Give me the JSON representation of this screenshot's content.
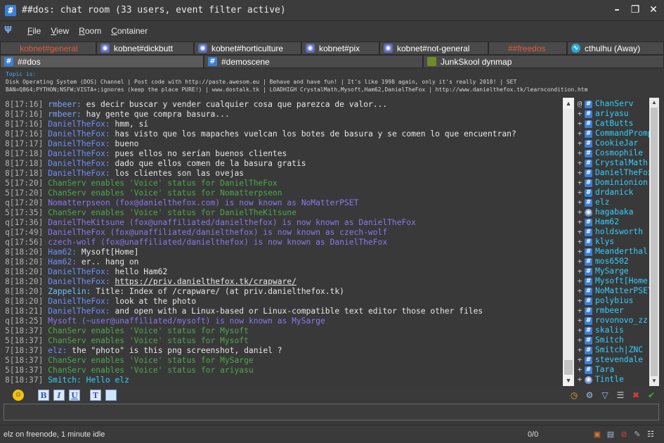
{
  "window": {
    "title": "##dos: chat room (33 users, event filter active)",
    "app_icon": "#"
  },
  "menu": [
    "File",
    "View",
    "Room",
    "Container"
  ],
  "tabs_row1": [
    {
      "label": "kobnet#general",
      "icon": "blank",
      "red": true
    },
    {
      "label": "kobnet#dickbutt",
      "icon": "discord",
      "red": false
    },
    {
      "label": "kobnet#horticulture",
      "icon": "discord",
      "red": false
    },
    {
      "label": "kobnet#pix",
      "icon": "discord",
      "red": false
    },
    {
      "label": "kobnet#not-general",
      "icon": "discord",
      "red": false
    },
    {
      "label": "##freedos",
      "icon": "blank",
      "red": true
    },
    {
      "label": "cthulhu (Away)",
      "icon": "cthulhu",
      "red": false
    }
  ],
  "tabs_row2": [
    {
      "label": "##dos",
      "icon": "hash",
      "active": true
    },
    {
      "label": "#demoscene",
      "icon": "hash",
      "active": false
    },
    {
      "label": "JunkSkool dynmap",
      "icon": "junk",
      "active": false
    }
  ],
  "topic": {
    "label": "Topic is:",
    "line1": "Disk Operating System (DOS) Channel | Post code with http://paste.awesom.eu | Behave and have fun! | It's like 1998 again, only it's really 2018! | SET",
    "line2": "BAN=Q864;PYTHON;NSFW;VISTA+;ignores (keep the place PURE!) | www.dostalk.tk | LOADHIGH CrystalMath,Mysoft,Ham62,DanielTheFox | http://www.danielthefox.tk/learncondition.htm"
  },
  "chat_lines": [
    {
      "prefix": "8",
      "time": "[17:16]",
      "nick": "rmbeer:",
      "text": "es decir buscar y vender cualquier cosa que parezca de valor...",
      "kind": "rmbeer"
    },
    {
      "prefix": "8",
      "time": "[17:16]",
      "nick": "rmbeer:",
      "text": "hay gente que compra basura...",
      "kind": "rmbeer"
    },
    {
      "prefix": "8",
      "time": "[17:16]",
      "nick": "DanielTheFox:",
      "text": "hmm, sí",
      "kind": "dan"
    },
    {
      "prefix": "8",
      "time": "[17:16]",
      "nick": "DanielTheFox:",
      "text": "has visto que los mapaches vuelcan los botes de basura y se comen lo que encuentran?",
      "kind": "dan"
    },
    {
      "prefix": "8",
      "time": "[17:17]",
      "nick": "DanielTheFox:",
      "text": "bueno",
      "kind": "dan"
    },
    {
      "prefix": "8",
      "time": "[17:18]",
      "nick": "DanielTheFox:",
      "text": "pues ellos no serían buenos clientes",
      "kind": "dan"
    },
    {
      "prefix": "8",
      "time": "[17:18]",
      "nick": "DanielTheFox:",
      "text": "dado que ellos comen de la basura gratis",
      "kind": "dan"
    },
    {
      "prefix": "8",
      "time": "[17:18]",
      "nick": "DanielTheFox:",
      "text": "los clientes son las ovejas",
      "kind": "dan"
    },
    {
      "prefix": "5",
      "time": "[17:20]",
      "nick": "",
      "text": "ChanServ enables 'Voice' status for DanielTheFox",
      "kind": "voice"
    },
    {
      "prefix": "5",
      "time": "[17:20]",
      "nick": "",
      "text": "ChanServ enables 'Voice' status for Nomatterpseon",
      "kind": "voice"
    },
    {
      "prefix": "q",
      "time": "[17:20]",
      "nick": "",
      "text": "Nomatterpseon (fox@danielthefox.com) is now known as NoMatterPSET",
      "kind": "nickchange"
    },
    {
      "prefix": "5",
      "time": "[17:35]",
      "nick": "",
      "text": "ChanServ enables 'Voice' status for DanielTheKitsune",
      "kind": "voice"
    },
    {
      "prefix": "q",
      "time": "[17:36]",
      "nick": "",
      "text": "DanielTheKitsune (fox@unaffiliated/danielthefox) is now known as DanielTheFox",
      "kind": "nickchange"
    },
    {
      "prefix": "q",
      "time": "[17:49]",
      "nick": "",
      "text": "DanielTheFox (fox@unaffiliated/danielthefox) is now known as czech-wolf",
      "kind": "nickchange"
    },
    {
      "prefix": "q",
      "time": "[17:56]",
      "nick": "",
      "text": "czech-wolf (fox@unaffiliated/danielthefox) is now known as DanielTheFox",
      "kind": "nickchange"
    },
    {
      "prefix": "8",
      "time": "[18:20]",
      "nick": "Ham62:",
      "text": "Mysoft[Home]",
      "kind": "ham"
    },
    {
      "prefix": "8",
      "time": "[18:20]",
      "nick": "Ham62:",
      "text": "er.. hang on",
      "kind": "ham"
    },
    {
      "prefix": "8",
      "time": "[18:20]",
      "nick": "DanielTheFox:",
      "text": "hello Ham62",
      "kind": "dan"
    },
    {
      "prefix": "8",
      "time": "[18:20]",
      "nick": "DanielTheFox:",
      "text": "https://priv.danielthefox.tk/crapware/",
      "kind": "danlink"
    },
    {
      "prefix": "8",
      "time": "[18:20]",
      "nick": "Zappelin:",
      "text": "Title: Index of /crapware/ (at priv.danielthefox.tk)",
      "kind": "zap"
    },
    {
      "prefix": "8",
      "time": "[18:20]",
      "nick": "DanielTheFox:",
      "text": "look at the photo",
      "kind": "dan"
    },
    {
      "prefix": "8",
      "time": "[18:21]",
      "nick": "DanielTheFox:",
      "text": "and open with a Linux-based or Linux-compatible text editor those other files",
      "kind": "dan"
    },
    {
      "prefix": "q",
      "time": "[18:25]",
      "nick": "",
      "text": "Mysoft (~user@unaffiliated/mysoft) is now known as MySarge",
      "kind": "nickchange"
    },
    {
      "prefix": "5",
      "time": "[18:37]",
      "nick": "",
      "text": "ChanServ enables 'Voice' status for Mysoft",
      "kind": "voice"
    },
    {
      "prefix": "5",
      "time": "[18:37]",
      "nick": "",
      "text": "ChanServ enables 'Voice' status for Mysoft",
      "kind": "voice"
    },
    {
      "prefix": "7",
      "time": "[18:37]",
      "nick": "elz:",
      "text": "the \"photo\" is this png screenshot, daniel ?",
      "kind": "elz"
    },
    {
      "prefix": "5",
      "time": "[18:37]",
      "nick": "",
      "text": "ChanServ enables 'Voice' status for MySarge",
      "kind": "voice"
    },
    {
      "prefix": "5",
      "time": "[18:37]",
      "nick": "",
      "text": "ChanServ enables 'Voice' status for ariyasu",
      "kind": "voice"
    },
    {
      "prefix": "8",
      "time": "[18:37]",
      "nick": "Smitch:",
      "text": "Hello elz",
      "kind": "smith"
    }
  ],
  "users": [
    {
      "mode": "@",
      "name": "ChanServ",
      "icon": "hash"
    },
    {
      "mode": "+",
      "name": "ariyasu",
      "icon": "hash"
    },
    {
      "mode": "+",
      "name": "CatButts",
      "icon": "hash"
    },
    {
      "mode": "+",
      "name": "CommandPrompt",
      "icon": "hash"
    },
    {
      "mode": "+",
      "name": "CookieJar",
      "icon": "hash"
    },
    {
      "mode": "+",
      "name": "Cosmophile",
      "icon": "hash"
    },
    {
      "mode": "+",
      "name": "CrystalMath",
      "icon": "hash"
    },
    {
      "mode": "+",
      "name": "DanielTheFox",
      "icon": "hash"
    },
    {
      "mode": "+",
      "name": "Dominionion",
      "icon": "hash"
    },
    {
      "mode": "+",
      "name": "drdanick",
      "icon": "hash"
    },
    {
      "mode": "+",
      "name": "elz",
      "icon": "hash"
    },
    {
      "mode": "+",
      "name": "hagabaka",
      "icon": "disc"
    },
    {
      "mode": "+",
      "name": "Ham62",
      "icon": "hash"
    },
    {
      "mode": "+",
      "name": "holdsworth",
      "icon": "hash"
    },
    {
      "mode": "+",
      "name": "klys",
      "icon": "hash"
    },
    {
      "mode": "+",
      "name": "Meanderthal",
      "icon": "hash"
    },
    {
      "mode": "+",
      "name": "mos6502",
      "icon": "hash"
    },
    {
      "mode": "+",
      "name": "MySarge",
      "icon": "hash"
    },
    {
      "mode": "+",
      "name": "Mysoft[Home]",
      "icon": "hash"
    },
    {
      "mode": "+",
      "name": "NoMatterPSET",
      "icon": "hash"
    },
    {
      "mode": "+",
      "name": "polybius",
      "icon": "hash"
    },
    {
      "mode": "+",
      "name": "rmbeer",
      "icon": "hash"
    },
    {
      "mode": "+",
      "name": "rovonovo_zz",
      "icon": "hash"
    },
    {
      "mode": "+",
      "name": "skalis",
      "icon": "hash"
    },
    {
      "mode": "+",
      "name": "Smitch",
      "icon": "hash"
    },
    {
      "mode": "+",
      "name": "Smitch|ZNC",
      "icon": "hash"
    },
    {
      "mode": "+",
      "name": "stevendale",
      "icon": "hash"
    },
    {
      "mode": "+",
      "name": "Tara",
      "icon": "hash"
    },
    {
      "mode": "+",
      "name": "Tintle",
      "icon": "disc"
    }
  ],
  "input": {
    "value": ""
  },
  "status": {
    "left": "elz on freenode, 1 minute idle",
    "count": "0/0"
  },
  "colors": {
    "voice_event": "#4ca84c",
    "nick_event": "#8a78f0",
    "nick": "#6e8fff",
    "accent": "#3a7fd5"
  }
}
